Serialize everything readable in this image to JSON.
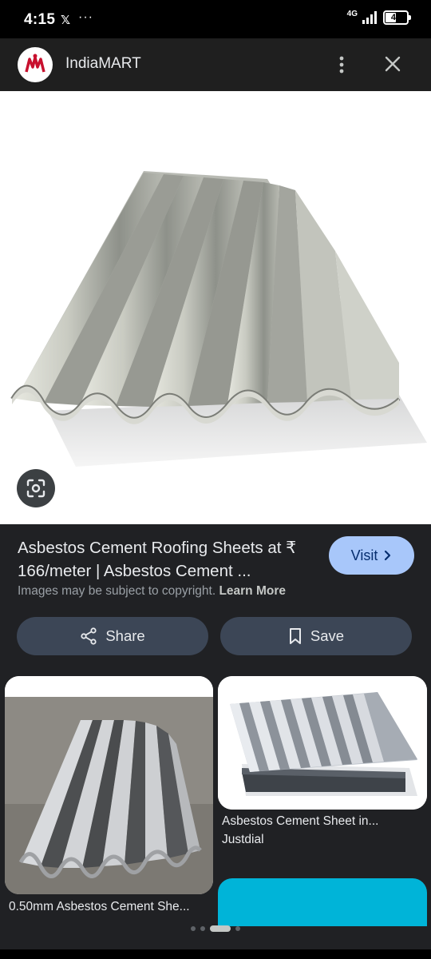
{
  "status_bar": {
    "time": "4:15",
    "notification_glyph": "𝕏",
    "more_glyph": "···",
    "network": "4G",
    "battery": "48"
  },
  "header": {
    "site_name": "IndiaMART",
    "logo_icon": "indiamart-logo",
    "more_icon": "more-vert-icon",
    "close_icon": "close-icon"
  },
  "result": {
    "title": "Asbestos Cement Roofing Sheets at ₹ 166/meter | Asbestos Cement ...",
    "visit_label": "Visit",
    "copyright_text": "Images may be subject to copyright.",
    "learn_more": "Learn More",
    "share_label": "Share",
    "save_label": "Save"
  },
  "related": [
    {
      "caption": "0.50mm Asbestos Cement She...",
      "source": ""
    },
    {
      "caption": "Asbestos Cement Sheet in...",
      "source": "Justdial"
    }
  ],
  "pager": {
    "count": 4,
    "active_index": 2
  },
  "colors": {
    "accent": "#a8c7fa",
    "panel": "#202124",
    "header": "#1f1f1f",
    "action_button": "#3c4656",
    "teal_card": "#00b4d8"
  }
}
